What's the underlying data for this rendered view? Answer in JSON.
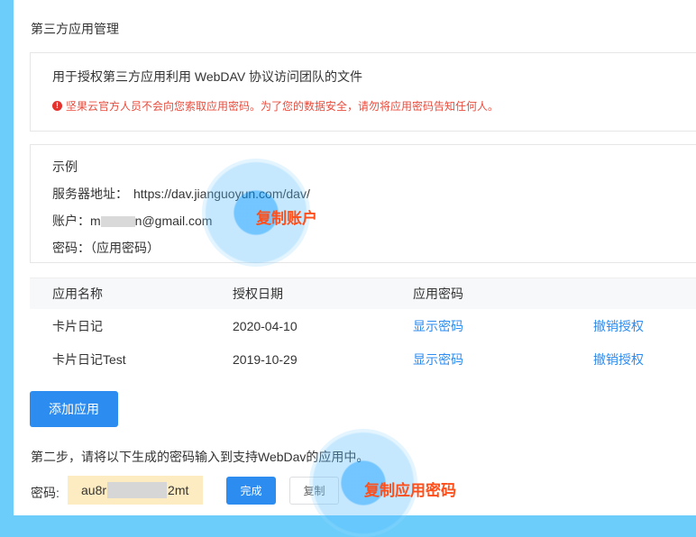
{
  "page": {
    "title": "第三方应用管理"
  },
  "intro": {
    "description": "用于授权第三方应用利用 WebDAV 协议访问团队的文件",
    "warning_icon": "!",
    "warning": "坚果云官方人员不会向您索取应用密码。为了您的数据安全，请勿将应用密码告知任何人。"
  },
  "example": {
    "title": "示例",
    "server_label": "服务器地址：",
    "server_value": "https://dav.jianguoyun.com/dav/",
    "account_label": "账户：",
    "account_prefix": "m",
    "account_suffix": "n@gmail.com",
    "password_label": "密码：",
    "password_value": "（应用密码）"
  },
  "table": {
    "headers": [
      "应用名称",
      "授权日期",
      "应用密码"
    ],
    "rows": [
      {
        "name": "卡片日记",
        "date": "2020-04-10",
        "show": "显示密码",
        "revoke": "撤销授权"
      },
      {
        "name": "卡片日记Test",
        "date": "2019-10-29",
        "show": "显示密码",
        "revoke": "撤销授权"
      }
    ]
  },
  "add_button": "添加应用",
  "step2": {
    "text": "第二步，请将以下生成的密码输入到支持WebDav的应用中。",
    "password_label": "密码:",
    "password_prefix": "au8r",
    "password_suffix": "2mt",
    "done_button": "完成",
    "copy_button": "复制"
  },
  "annotations": {
    "copy_account": "复制账户",
    "copy_app_password": "复制应用密码"
  },
  "colors": {
    "background": "#6ccdfa",
    "accent": "#2d8cf0",
    "warning": "#e84c3d",
    "annotation": "#ff4e19",
    "password_field": "#fdebc2"
  }
}
